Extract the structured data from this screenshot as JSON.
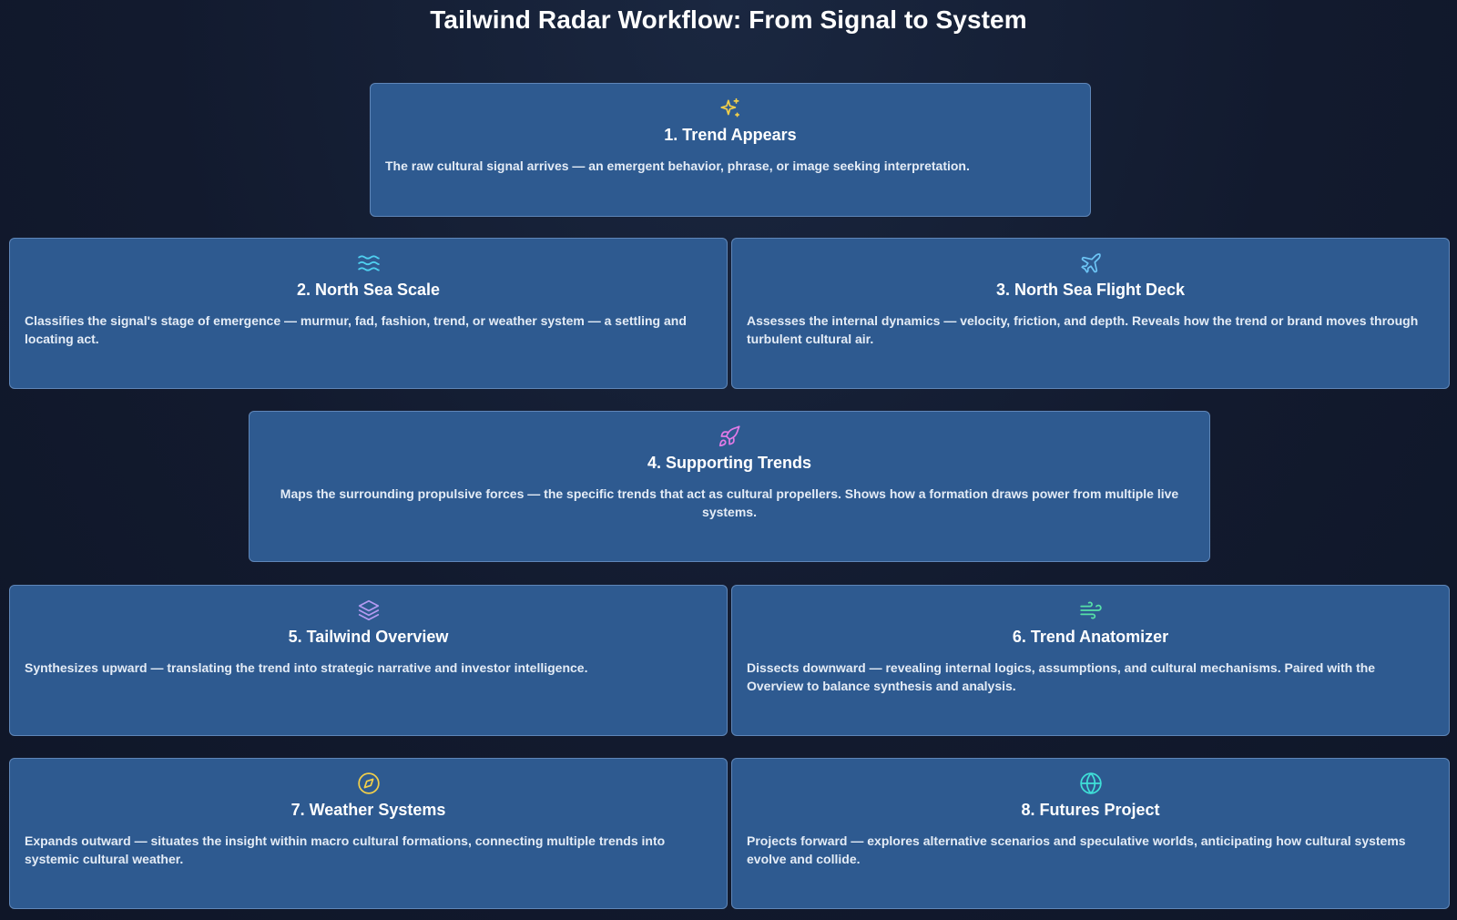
{
  "title": "Tailwind Radar Workflow: From Signal to System",
  "colors": {
    "background": "#121a2e",
    "card": "#2e5a90",
    "card_border": "#5f86b8"
  },
  "steps": [
    {
      "title": "1. Trend Appears",
      "description": "The raw cultural signal arrives — an emergent behavior, phrase, or image seeking interpretation.",
      "icon": "sparkles-icon",
      "icon_color": "#f2cf4a"
    },
    {
      "title": "2. North Sea Scale",
      "description": "Classifies the signal's stage of emergence — murmur, fad, fashion, trend, or weather system — a settling and locating act.",
      "icon": "waves-icon",
      "icon_color": "#4fd0f0"
    },
    {
      "title": "3. North Sea Flight Deck",
      "description": "Assesses the internal dynamics — velocity, friction, and depth. Reveals how the trend or brand moves through turbulent cultural air.",
      "icon": "plane-icon",
      "icon_color": "#6cc4f5"
    },
    {
      "title": "4. Supporting Trends",
      "description": "Maps the surrounding propulsive forces — the specific trends that act as cultural propellers. Shows how a formation draws power from multiple live systems.",
      "icon": "rocket-icon",
      "icon_color": "#e07ae6"
    },
    {
      "title": "5. Tailwind Overview",
      "description": "Synthesizes upward — translating the trend into strategic narrative and investor intelligence.",
      "icon": "layers-icon",
      "icon_color": "#b49af2"
    },
    {
      "title": "6. Trend Anatomizer",
      "description": "Dissects downward — revealing internal logics, assumptions, and cultural mechanisms. Paired with the Overview to balance synthesis and analysis.",
      "icon": "wind-icon",
      "icon_color": "#56e0a8"
    },
    {
      "title": "7. Weather Systems",
      "description": "Expands outward — situates the insight within macro cultural formations, connecting multiple trends into systemic cultural weather.",
      "icon": "compass-icon",
      "icon_color": "#f2cf4a"
    },
    {
      "title": "8. Futures Project",
      "description": "Projects forward — explores alternative scenarios and speculative worlds, anticipating how cultural systems evolve and collide.",
      "icon": "globe-icon",
      "icon_color": "#3fe0d8"
    }
  ]
}
